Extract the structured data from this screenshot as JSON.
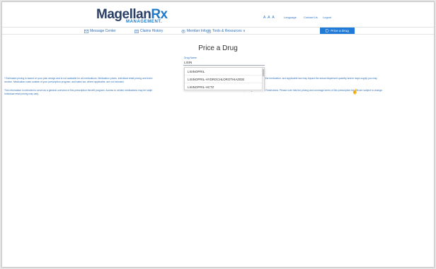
{
  "brand": {
    "name_part1": "Magellan",
    "name_part2": "Rx",
    "sub": "MANAGEMENT."
  },
  "utility_links": {
    "font_size": "A A A",
    "language": "Language",
    "contact": "Contact Us",
    "logout": "Logout"
  },
  "nav": [
    {
      "label": "Message Center",
      "icon": "envelope-icon"
    },
    {
      "label": "Claims History",
      "icon": "document-icon"
    },
    {
      "label": "Member Info ∨",
      "icon": "person-icon"
    },
    {
      "label": "Tools & Resources ∨",
      "icon": "tools-icon"
    }
  ],
  "price_button": {
    "label": "Price a Drug",
    "icon": "price-tag-icon"
  },
  "page": {
    "title": "Price a Drug"
  },
  "form": {
    "drug_label": "Drug Name",
    "drug_value": "LISIN"
  },
  "suggestions": [
    "LISINOPRIL",
    "LISINOPRIL-HYDROCHLOROTHIAZIDE",
    "LISINOPRIL-HCTZ"
  ],
  "disclaimer": {
    "line1a": "* Estimated pricing is based on your plan design and is not available for all medications. Medication prices, individual retail pricing and indivi",
    "line1b": "nstructions on how to take the medication, and applicable law may impact the actual dispensed quantity and/or days supply you may",
    "line1c": "receive. Medication costs outside of your prescription program, and sales tax, where applicable, are not included.",
    "line2a": "This information is intended to serve as a general overview of this prescription benefit program. Access to certain medications may be subje",
    "line2b": "s, and Age or Gender Restrictions. Please note that the pricing and coverage terms of this prescription benefit are subject to change.",
    "line2c": "Individual retail pricing may vary."
  },
  "colors": {
    "accent": "#1f7ad8",
    "brand_dark": "#2a3f66",
    "link": "#2f6fb7"
  }
}
